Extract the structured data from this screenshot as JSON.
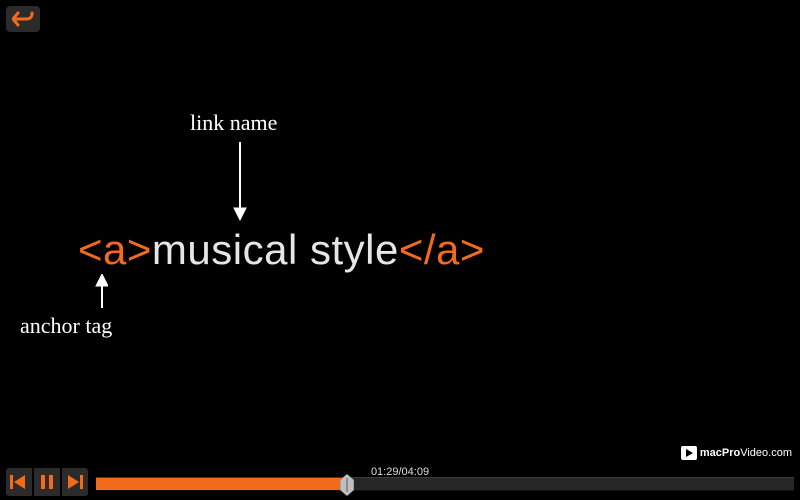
{
  "colors": {
    "accent": "#f26b1b",
    "bg": "#000000",
    "text_light": "#e6e6e6"
  },
  "back_button": {
    "name": "back"
  },
  "slide": {
    "annot_link_name": "link name",
    "annot_anchor_tag": "anchor tag",
    "code": {
      "open_tag": "<a>",
      "content": "musical style",
      "close_tag": "</a>"
    }
  },
  "player": {
    "prev": "previous",
    "play_pause": "pause",
    "next": "next",
    "time_current": "01:29",
    "time_sep": "/",
    "time_total": "04:09",
    "progress_pct": 36
  },
  "brand": {
    "bold": "macPro",
    "thin": "Video.com"
  }
}
